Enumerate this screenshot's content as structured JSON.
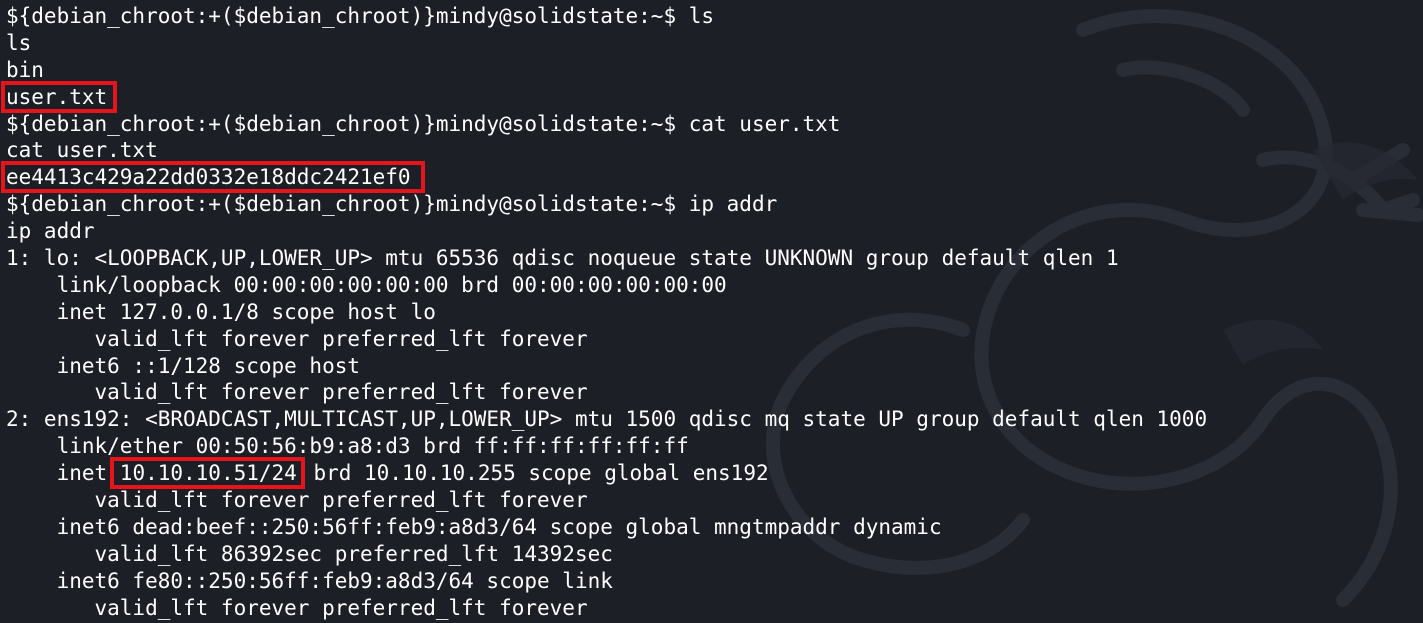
{
  "terminal": {
    "prompt": "${debian_chroot:+($debian_chroot)}mindy@solidstate:~$ ",
    "lines": [
      {
        "kind": "prompt",
        "cmd": "ls"
      },
      {
        "kind": "echo",
        "text": "ls"
      },
      {
        "kind": "out",
        "text": "bin"
      },
      {
        "kind": "hl",
        "text": "user.txt",
        "style": "hl-sm"
      },
      {
        "kind": "prompt",
        "cmd": "cat user.txt"
      },
      {
        "kind": "echo",
        "text": "cat user.txt"
      },
      {
        "kind": "hl",
        "text": "ee4413c429a22dd0332e18ddc2421ef0",
        "style": "hl-hash"
      },
      {
        "kind": "prompt",
        "cmd": "ip addr"
      },
      {
        "kind": "echo",
        "text": "ip addr"
      },
      {
        "kind": "out",
        "text": "1: lo: <LOOPBACK,UP,LOWER_UP> mtu 65536 qdisc noqueue state UNKNOWN group default qlen 1"
      },
      {
        "kind": "out",
        "text": "    link/loopback 00:00:00:00:00:00 brd 00:00:00:00:00:00"
      },
      {
        "kind": "out",
        "text": "    inet 127.0.0.1/8 scope host lo"
      },
      {
        "kind": "out",
        "text": "       valid_lft forever preferred_lft forever"
      },
      {
        "kind": "out",
        "text": "    inet6 ::1/128 scope host"
      },
      {
        "kind": "out",
        "text": "       valid_lft forever preferred_lft forever"
      },
      {
        "kind": "out",
        "text": "2: ens192: <BROADCAST,MULTICAST,UP,LOWER_UP> mtu 1500 qdisc mq state UP group default qlen 1000"
      },
      {
        "kind": "out",
        "text": "    link/ether 00:50:56:b9:a8:d3 brd ff:ff:ff:ff:ff:ff"
      },
      {
        "kind": "split",
        "before": "    inet ",
        "hl": "10.10.10.51/24",
        "after": " brd 10.10.10.255 scope global ens192",
        "style": "hl-ip"
      },
      {
        "kind": "out",
        "text": "       valid_lft forever preferred_lft forever"
      },
      {
        "kind": "out",
        "text": "    inet6 dead:beef::250:56ff:feb9:a8d3/64 scope global mngtmpaddr dynamic"
      },
      {
        "kind": "out",
        "text": "       valid_lft 86392sec preferred_lft 14392sec"
      },
      {
        "kind": "out",
        "text": "    inet6 fe80::250:56ff:feb9:a8d3/64 scope link"
      },
      {
        "kind": "out",
        "text": "       valid_lft forever preferred_lft forever"
      }
    ]
  },
  "colors": {
    "background": "#1c1f26",
    "text": "#ffffff",
    "highlight_box": "#e8141c"
  },
  "icons": {
    "background_logo": "kali-dragon-icon"
  }
}
